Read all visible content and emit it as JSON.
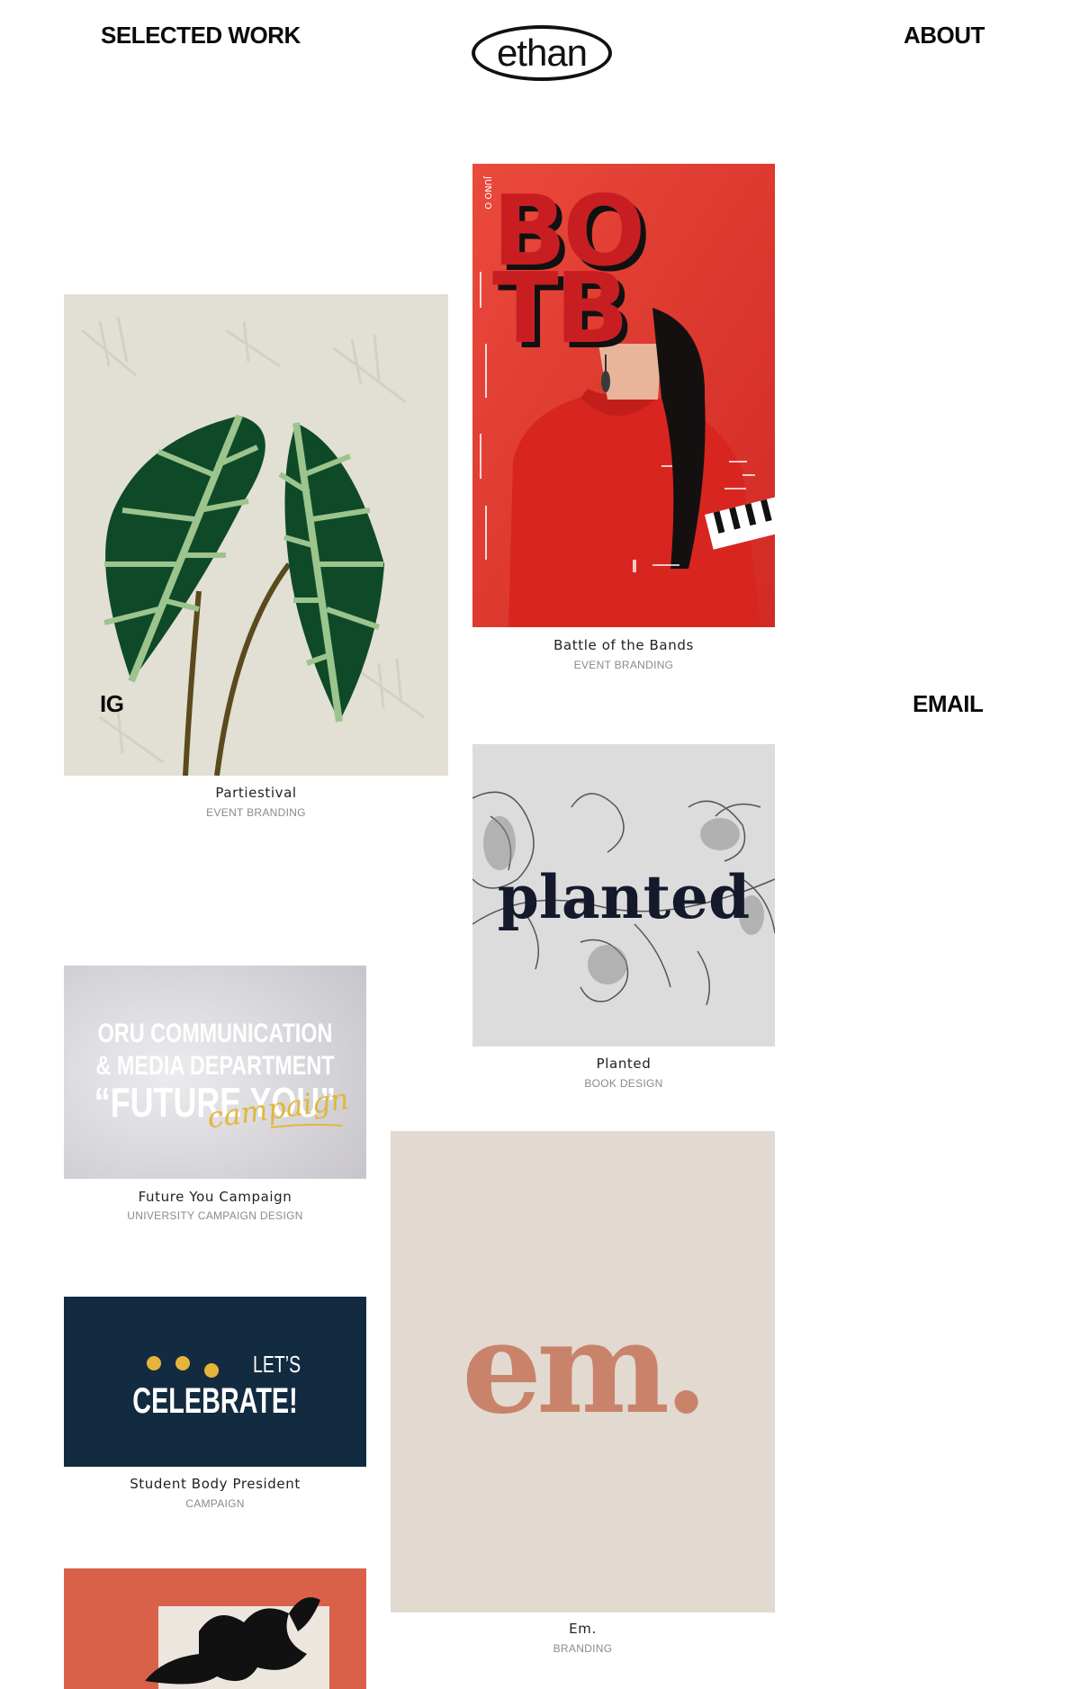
{
  "nav": {
    "selected_work": "SELECTED WORK",
    "about": "ABOUT",
    "ig": "IG",
    "email": "EMAIL"
  },
  "logo": {
    "text": "ethan"
  },
  "projects": [
    {
      "title": "Battle of the Bands",
      "category": "EVENT BRANDING",
      "art_text_top": "BO",
      "art_text_bottom": "TB",
      "art_side": "JUNO O"
    },
    {
      "title": "Partiestival",
      "category": "EVENT BRANDING"
    },
    {
      "title": "Planted",
      "category": "BOOK DESIGN",
      "art_text": "planted"
    },
    {
      "title": "Future You Campaign",
      "category": "UNIVERSITY CAMPAIGN DESIGN",
      "art_line1": "ORU COMMUNICATION",
      "art_line2": "& MEDIA DEPARTMENT",
      "art_line3": "“FUTURE YOU”",
      "art_script": "campaign"
    },
    {
      "title": "Em.",
      "category": "BRANDING",
      "art_text": "em."
    },
    {
      "title": "Student Body President",
      "category": "CAMPAIGN",
      "art_line1": "LET’S",
      "art_line2": "CELEBRATE!"
    }
  ],
  "colors": {
    "botb_red": "#e23a2e",
    "partiestival_bg": "#e2dfd4",
    "leaf_green": "#0f4a28",
    "planted_bg": "#dcdcdc",
    "future_bg": "#d6d5da",
    "em_bg": "#e2d9d0",
    "em_text": "#c9836a",
    "celebrate_bg": "#132b40",
    "celebrate_dot": "#e5b43a",
    "orange_card": "#d9614a"
  }
}
